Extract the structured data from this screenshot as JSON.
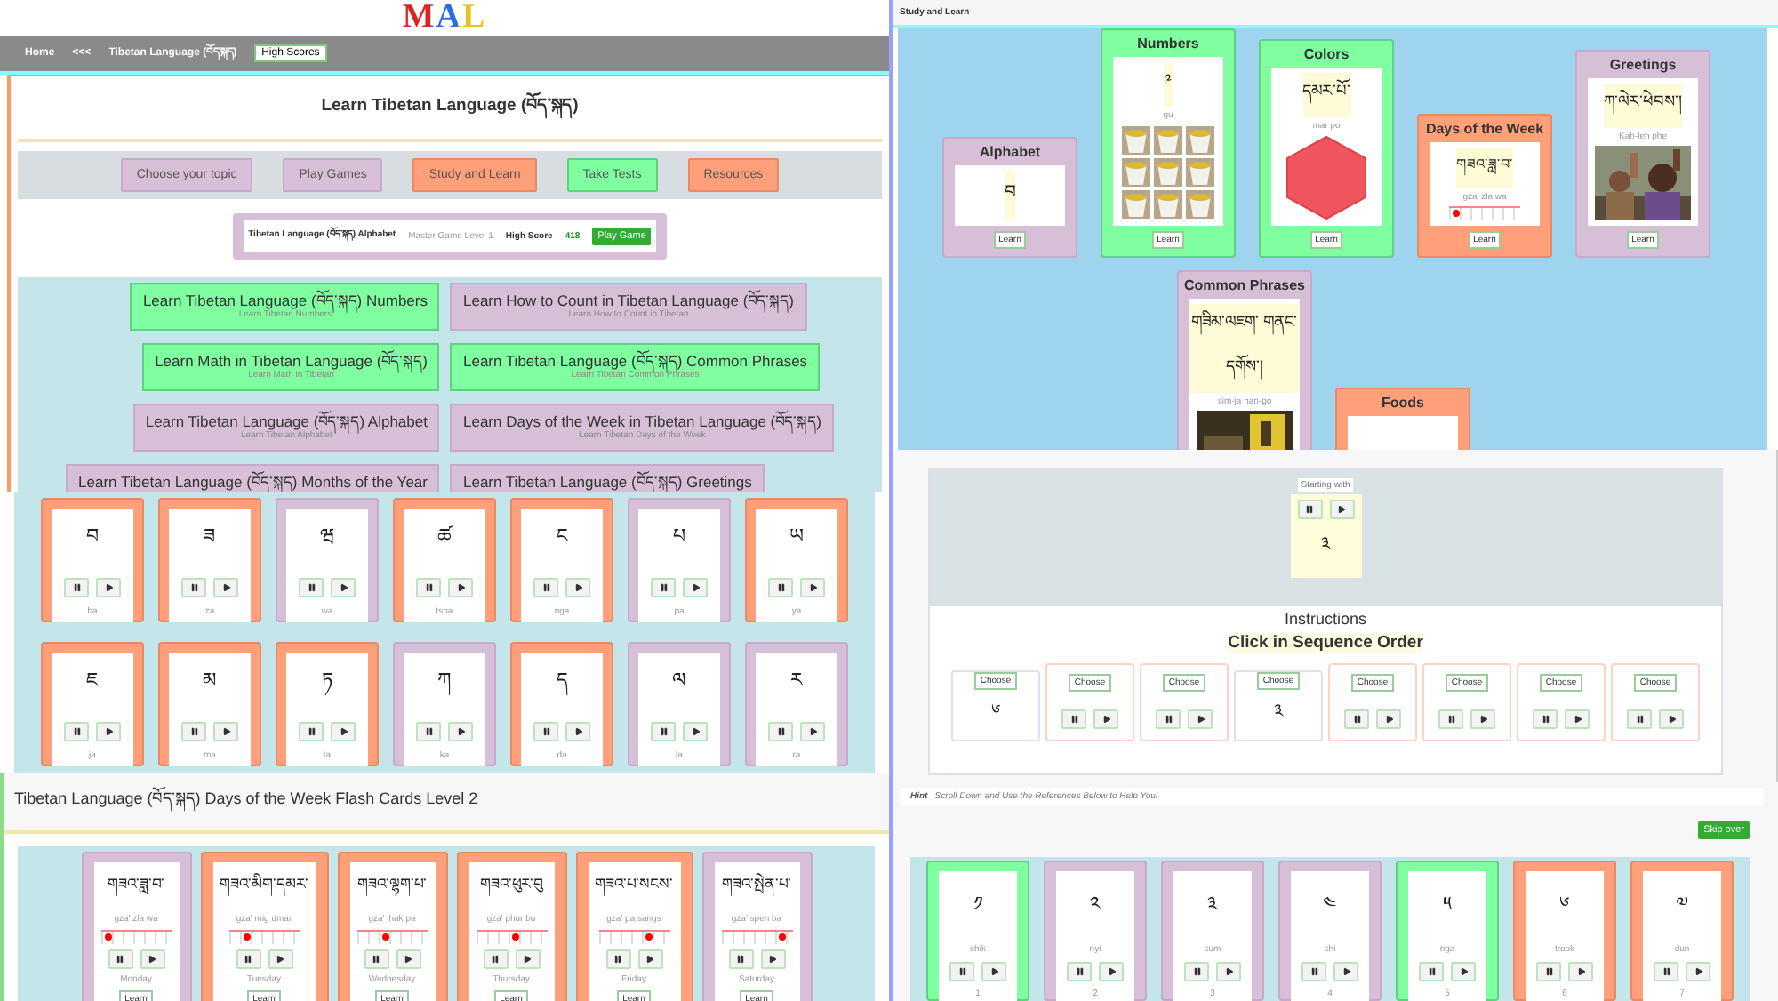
{
  "logo": "MAL",
  "nav": {
    "items": [
      "Home",
      "<<<",
      "Tibetan Language (བོད་སྐད)"
    ],
    "high_scores": "High Scores"
  },
  "learn_panel": {
    "title": "Learn Tibetan Language (བོད་སྐད)",
    "menu": [
      {
        "label": "Choose your topic",
        "color": "#d8bfd8"
      },
      {
        "label": "Play Games",
        "color": "#d8bfd8"
      },
      {
        "label": "Study and Learn",
        "color": "#ffa07a"
      },
      {
        "label": "Take Tests",
        "color": "#7fffa0"
      },
      {
        "label": "Resources",
        "color": "#ffa07a"
      }
    ],
    "game_bar": {
      "name": "Tibetan Language (བོད་སྐད) Alphabet",
      "level": "Master Game Level 1",
      "score_label": "High Score",
      "score": "418",
      "button": "Play Game"
    },
    "topics": [
      {
        "title": "Learn Tibetan Language (བོད་སྐད) Numbers",
        "subtitle": "Learn Tibetan Numbers",
        "color": "#7fffa0"
      },
      {
        "title": "Learn How to Count in Tibetan Language (བོད་སྐད)",
        "subtitle": "Learn How to Count in Tibetan",
        "color": "#d8bfd8"
      },
      {
        "title": "Learn Math in Tibetan Language (བོད་སྐད)",
        "subtitle": "Learn Math in Tibetan",
        "color": "#7fffa0"
      },
      {
        "title": "Learn Tibetan Language (བོད་སྐད) Common Phrases",
        "subtitle": "Learn Tibetan Common Phrases",
        "color": "#7fffa0"
      },
      {
        "title": "Learn Tibetan Language (བོད་སྐད) Alphabet",
        "subtitle": "Learn Tibetan Alphabet",
        "color": "#d8bfd8"
      },
      {
        "title": "Learn Days of the Week in Tibetan Language (བོད་སྐད)",
        "subtitle": "Learn Tibetan Days of the Week",
        "color": "#d8bfd8"
      },
      {
        "title": "Learn Tibetan Language (བོད་སྐད) Months of the Year",
        "color": "#d8bfd8"
      },
      {
        "title": "Learn Tibetan Language (བོད་སྐད) Greetings",
        "color": "#d8bfd8"
      }
    ]
  },
  "letter_cards": [
    {
      "glyph": "བ",
      "name": "ba",
      "color": "#ffa07a"
    },
    {
      "glyph": "ཟ",
      "name": "za",
      "color": "#ffa07a"
    },
    {
      "glyph": "ཝ",
      "name": "wa",
      "color": "#d8bfd8"
    },
    {
      "glyph": "ཚ",
      "name": "tsha",
      "color": "#ffa07a"
    },
    {
      "glyph": "ང",
      "name": "nga",
      "color": "#ffa07a"
    },
    {
      "glyph": "པ",
      "name": "pa",
      "color": "#d8bfd8"
    },
    {
      "glyph": "ཡ",
      "name": "ya",
      "color": "#ffa07a"
    },
    {
      "glyph": "ཇ",
      "name": "ja",
      "color": "#ffa07a"
    },
    {
      "glyph": "མ",
      "name": "ma",
      "color": "#ffa07a"
    },
    {
      "glyph": "ཏ",
      "name": "ta",
      "color": "#ffa07a"
    },
    {
      "glyph": "ཀ",
      "name": "ka",
      "color": "#d8bfd8"
    },
    {
      "glyph": "ད",
      "name": "da",
      "color": "#ffa07a"
    },
    {
      "glyph": "ལ",
      "name": "la",
      "color": "#d8bfd8"
    },
    {
      "glyph": "ར",
      "name": "ra",
      "color": "#d8bfd8"
    }
  ],
  "days_flash": {
    "title": "Tibetan Language (བོད་སྐད) Days of the Week Flash Cards Level 2",
    "cards": [
      {
        "glyph": "གཟའ་ཟླ་བ་",
        "roman": "gza' zla wa",
        "day": "Monday",
        "button": "Learn",
        "level": 0.05,
        "color": "#d8bfd8"
      },
      {
        "glyph": "གཟའ་མིག་དམར་",
        "roman": "gza' mig dmar",
        "day": "Tuesday",
        "button": "Learn",
        "level": 0.2,
        "color": "#ffa07a"
      },
      {
        "glyph": "གཟའ་ལྷག་པ་",
        "roman": "gza' lhak pa",
        "day": "Wednesday",
        "button": "Learn",
        "level": 0.35,
        "color": "#ffa07a"
      },
      {
        "glyph": "གཟའ་ཕུར་བུ",
        "roman": "gza' phur bu",
        "day": "Thursday",
        "button": "Learn",
        "level": 0.5,
        "color": "#ffa07a"
      },
      {
        "glyph": "གཟའ་པ་སངས་",
        "roman": "gza' pa sangs",
        "day": "Friday",
        "button": "Learn",
        "level": 0.65,
        "color": "#ffa07a"
      },
      {
        "glyph": "གཟའ་སྤེན་པ་",
        "roman": "gza' spen ba",
        "day": "Saturday",
        "button": "Learn",
        "level": 0.8,
        "color": "#d8bfd8"
      }
    ]
  },
  "study": {
    "title": "Study and Learn",
    "cards": [
      {
        "kind": "glyph",
        "title": "Alphabet",
        "glyph": "བ",
        "button": "Learn",
        "color": "#d8bfd8"
      },
      {
        "kind": "picture",
        "title": "Numbers",
        "glyph": "༩",
        "roman": "gu",
        "button": "Learn",
        "color": "#7fffa0"
      },
      {
        "kind": "shape",
        "title": "Colors",
        "glyph": "དམར་པོ་",
        "roman": "mar po",
        "button": "Learn",
        "color": "#7fffa0"
      },
      {
        "kind": "scale",
        "title": "Days of the Week",
        "glyph": "གཟའ་ཟླ་བ་",
        "roman": "gza' zla wa",
        "level": 0.05,
        "button": "Learn",
        "color": "#ffa07a"
      },
      {
        "kind": "picture",
        "title": "Greetings",
        "glyph": "ཀ་ལེར་ཕེབས་།",
        "roman": "Kah-leh phe",
        "button": "Learn",
        "color": "#d8bfd8"
      }
    ],
    "more_cards": [
      {
        "kind": "picture",
        "title": "Common Phrases",
        "glyph": "གཟིམ་ལཇག་ གནང་དགོས་།",
        "roman": "sim-ja nan-go",
        "color": "#d8bfd8"
      },
      {
        "kind": "title",
        "title": "Foods",
        "color": "#ffa07a"
      }
    ]
  },
  "sequence": {
    "start_label": "Starting with",
    "start_glyph": "༣",
    "instructions": "Instructions",
    "prompt": "Click in Sequence Order",
    "choices": [
      {
        "kind": "glyph",
        "button": "Choose",
        "glyph": "༦"
      },
      {
        "kind": "audio",
        "button": "Choose"
      },
      {
        "kind": "audio",
        "button": "Choose"
      },
      {
        "kind": "glyph",
        "button": "Choose",
        "glyph": "༣"
      },
      {
        "kind": "audio",
        "button": "Choose"
      },
      {
        "kind": "audio",
        "button": "Choose"
      },
      {
        "kind": "audio",
        "button": "Choose"
      },
      {
        "kind": "audio",
        "button": "Choose"
      }
    ]
  },
  "hint": {
    "label": "Hint",
    "text": "Scroll Down and Use the References Below to Help You!"
  },
  "skip": "Skip over",
  "number_cards": [
    {
      "glyph": "༡",
      "roman": "chik",
      "number": "1",
      "color": "#7fffa0"
    },
    {
      "glyph": "༢",
      "roman": "nyi",
      "number": "2",
      "color": "#d8bfd8"
    },
    {
      "glyph": "༣",
      "roman": "sum",
      "number": "3",
      "color": "#d8bfd8"
    },
    {
      "glyph": "༤",
      "roman": "shi",
      "number": "4",
      "color": "#d8bfd8"
    },
    {
      "glyph": "༥",
      "roman": "nga",
      "number": "5",
      "color": "#7fffa0"
    },
    {
      "glyph": "༦",
      "roman": "trook",
      "number": "6",
      "color": "#ffa07a"
    },
    {
      "glyph": "༧",
      "roman": "dun",
      "number": "7",
      "color": "#ffa07a"
    }
  ]
}
